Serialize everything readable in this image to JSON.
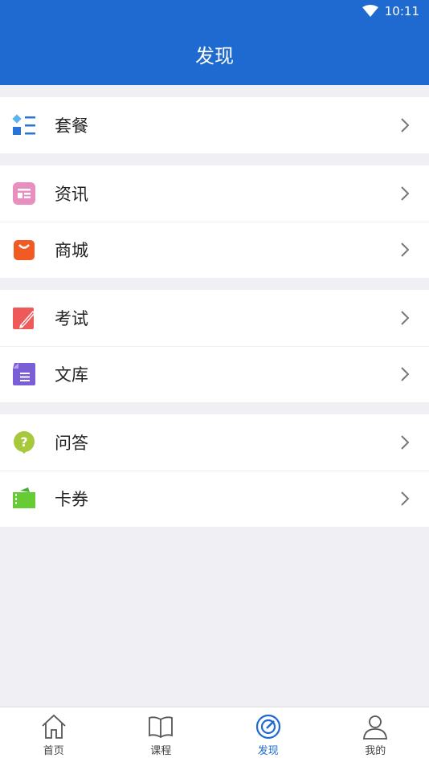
{
  "status": {
    "time": "10:11"
  },
  "header": {
    "title": "发现"
  },
  "groups": [
    {
      "items": [
        {
          "label": "套餐",
          "icon": "package-icon"
        }
      ]
    },
    {
      "items": [
        {
          "label": "资讯",
          "icon": "news-icon"
        },
        {
          "label": "商城",
          "icon": "shop-bag-icon"
        }
      ]
    },
    {
      "items": [
        {
          "label": "考试",
          "icon": "exam-icon"
        },
        {
          "label": "文库",
          "icon": "library-doc-icon"
        }
      ]
    },
    {
      "items": [
        {
          "label": "问答",
          "icon": "qa-icon"
        },
        {
          "label": "卡券",
          "icon": "coupon-icon"
        }
      ]
    }
  ],
  "tabs": [
    {
      "label": "首页",
      "icon": "home-icon",
      "active": false
    },
    {
      "label": "课程",
      "icon": "book-icon",
      "active": false
    },
    {
      "label": "发现",
      "icon": "discover-icon",
      "active": true
    },
    {
      "label": "我的",
      "icon": "user-icon",
      "active": false
    }
  ],
  "colors": {
    "primary": "#1e6ad0",
    "background": "#efeff4"
  }
}
